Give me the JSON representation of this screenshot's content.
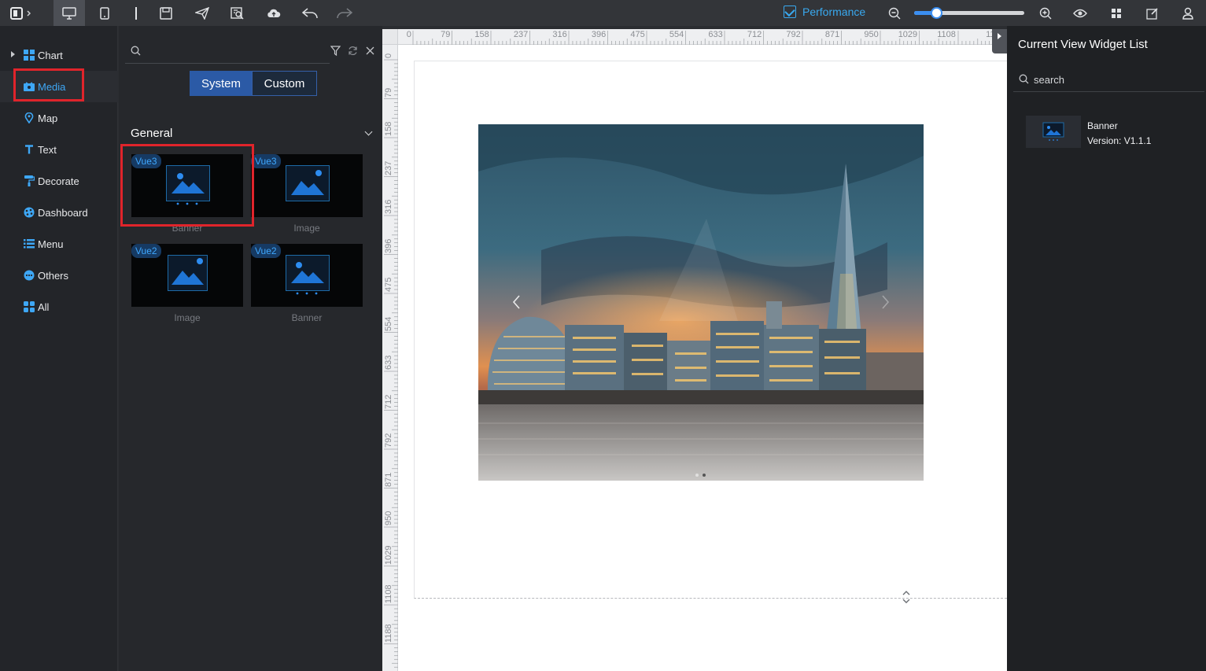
{
  "toolbar": {
    "performance_label": "Performance",
    "zoom_level": 0.2,
    "accent": "#3b8ef0"
  },
  "leftnav": {
    "items": [
      {
        "label": "Chart",
        "icon": "grid-chart-icon"
      },
      {
        "label": "Media",
        "icon": "media-icon"
      },
      {
        "label": "Map",
        "icon": "map-pin-icon"
      },
      {
        "label": "Text",
        "icon": "text-icon"
      },
      {
        "label": "Decorate",
        "icon": "paint-roller-icon"
      },
      {
        "label": "Dashboard",
        "icon": "dashboard-icon"
      },
      {
        "label": "Menu",
        "icon": "list-menu-icon"
      },
      {
        "label": "Others",
        "icon": "more-dots-icon"
      },
      {
        "label": "All",
        "icon": "all-grid-icon"
      }
    ],
    "active_index": 1
  },
  "widgets": {
    "search_value": "",
    "tabs": [
      "System",
      "Custom"
    ],
    "group_title": "General",
    "cards": [
      {
        "badge": "Vue3",
        "label": "Banner"
      },
      {
        "badge": "Vue3",
        "label": "Image"
      },
      {
        "badge": "Vue2",
        "label": "Image"
      },
      {
        "badge": "Vue2",
        "label": "Banner"
      }
    ]
  },
  "ruler": {
    "h_ticks": [
      "0",
      "79",
      "158",
      "237",
      "316",
      "396",
      "475",
      "554",
      "633",
      "712",
      "792",
      "871",
      "950",
      "1029",
      "1108",
      "11"
    ],
    "v_ticks": [
      "0",
      "79",
      "158",
      "237",
      "316",
      "396",
      "475",
      "554",
      "633",
      "712",
      "792",
      "871",
      "950",
      "1029",
      "1108",
      "1188"
    ]
  },
  "right_panel": {
    "title": "Current View Widget List",
    "search_placeholder": "search",
    "items": [
      {
        "name": "Banner",
        "version": "Version: V1.1.1"
      }
    ]
  }
}
